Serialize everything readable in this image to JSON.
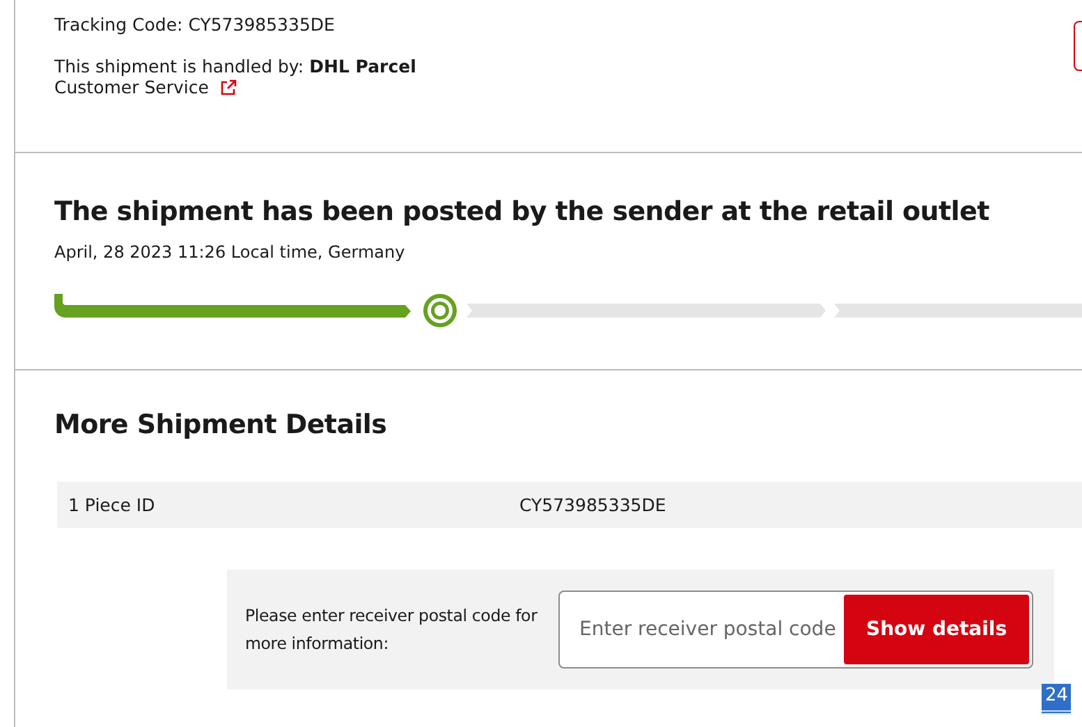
{
  "header": {
    "tracking_code": "Tracking Code: CY573985335DE",
    "handled_by": "This shipment is handled by: **DHL Parcel**",
    "customer_service_link": "Customer Service"
  },
  "status": {
    "title": "The shipment has been posted by the sender at the retail outlet",
    "timestamp": "April, 28 2023 11:26 Local time, Germany",
    "steps": [
      {
        "kind": "done"
      },
      {
        "kind": "current"
      },
      {
        "kind": "pending"
      },
      {
        "kind": "pending"
      }
    ]
  },
  "details": {
    "title": "More Shipment Details",
    "rows": [
      {
        "label": "1 Piece ID",
        "value": "CY573985335DE"
      }
    ],
    "postal_prompt": "Please enter receiver postal code for more information:",
    "postal_field": {
      "placeholder": "Enter receiver postal code"
    },
    "button": "Show details"
  },
  "badge": "24"
}
